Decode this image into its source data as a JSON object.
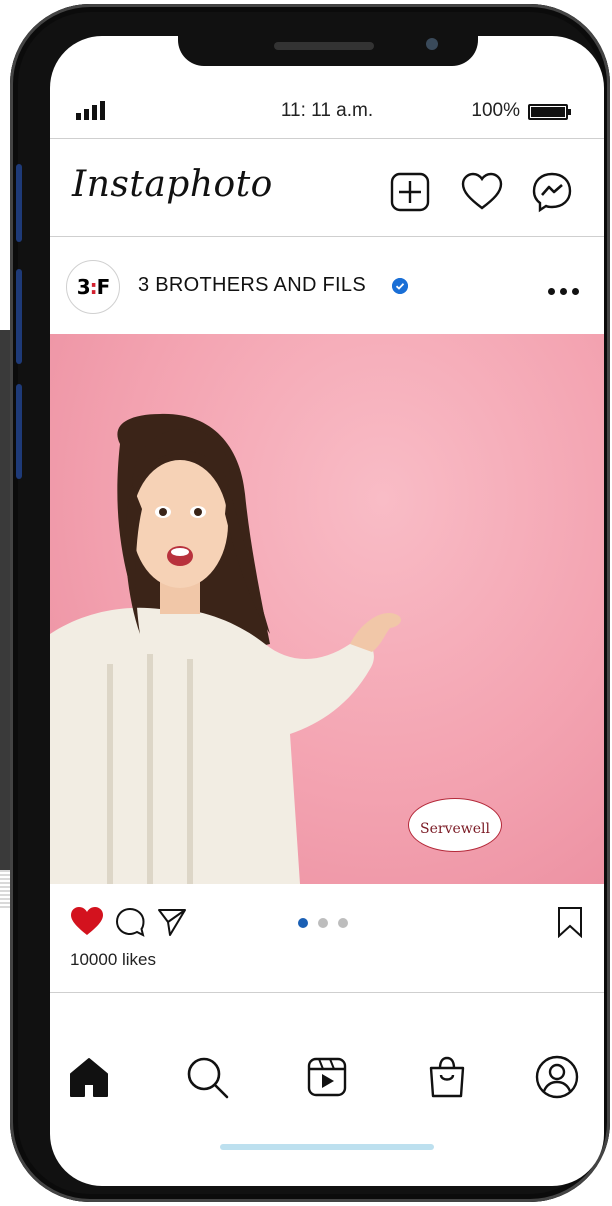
{
  "status_bar": {
    "time": "11: 11 a.m.",
    "battery": "100%"
  },
  "header": {
    "app_name": "Instaphoto",
    "icons": [
      "add-post-icon",
      "heart-icon",
      "messenger-icon"
    ]
  },
  "post": {
    "avatar_text_left": "3",
    "avatar_text_mid": ":",
    "avatar_text_right": "F",
    "account_name": "3 BROTHERS AND FILS",
    "verified": true,
    "badge_text": "Servewell",
    "carousel_index": 1,
    "carousel_count": 3,
    "liked": true,
    "likes_text": "10000 likes"
  },
  "nav": {
    "items": [
      "home-icon",
      "search-icon",
      "reels-icon",
      "shop-icon",
      "profile-icon"
    ]
  },
  "colors": {
    "like_red": "#d3121e",
    "verified_blue": "#1a6fd6",
    "carousel_active": "#1a5fb4",
    "post_background": "#f3a2b0"
  }
}
